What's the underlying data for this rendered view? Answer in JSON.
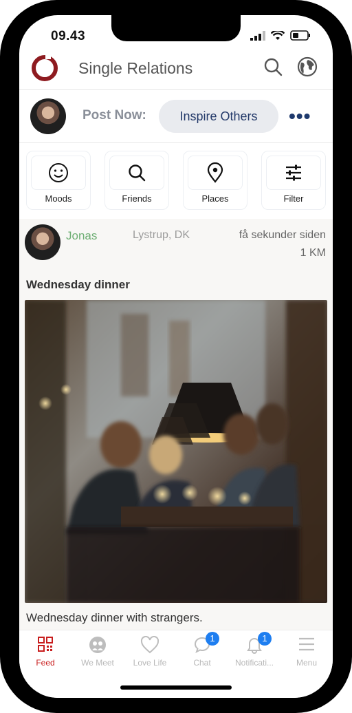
{
  "status": {
    "time": "09.43"
  },
  "header": {
    "title": "Single Relations",
    "search_icon": "search-icon",
    "globe_icon": "globe-icon",
    "brand_color": "#8e1b20"
  },
  "composer": {
    "label": "Post Now:",
    "button": "Inspire Others",
    "more": "•••"
  },
  "filters": [
    {
      "label": "Moods",
      "icon": "smiley-icon"
    },
    {
      "label": "Friends",
      "icon": "search-icon"
    },
    {
      "label": "Places",
      "icon": "location-pin-icon"
    },
    {
      "label": "Filter",
      "icon": "sliders-icon"
    }
  ],
  "post": {
    "user": "Jonas",
    "location": "Lystrup, DK",
    "time": "få sekunder siden",
    "distance": "1 KM",
    "title": "Wednesday dinner",
    "caption": "Wednesday dinner with strangers."
  },
  "tabs": [
    {
      "label": "Feed",
      "icon": "feed-icon",
      "active": true
    },
    {
      "label": "We Meet",
      "icon": "we-meet-icon"
    },
    {
      "label": "Love Life",
      "icon": "heart-icon"
    },
    {
      "label": "Chat",
      "icon": "chat-icon",
      "badge": "1"
    },
    {
      "label": "Notificati...",
      "icon": "bell-icon",
      "badge": "1"
    },
    {
      "label": "Menu",
      "icon": "menu-icon"
    }
  ]
}
